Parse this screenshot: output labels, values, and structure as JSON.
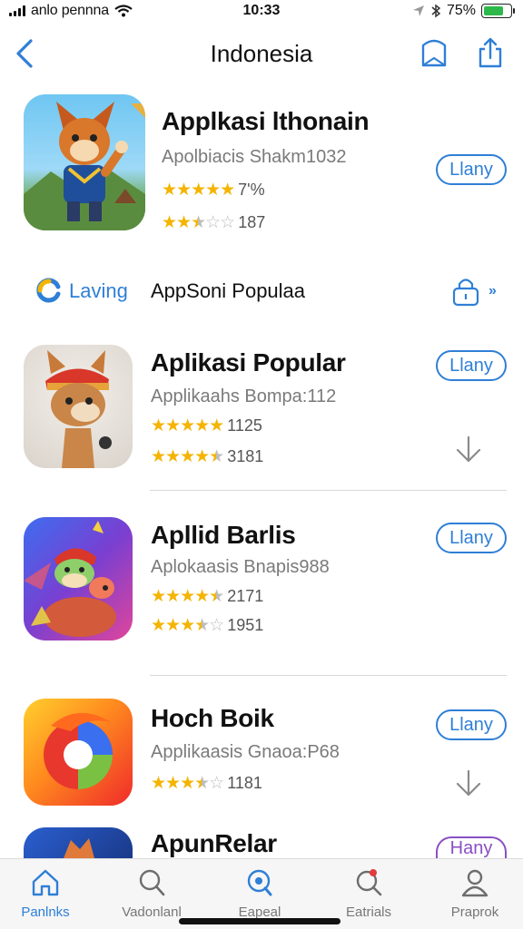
{
  "status_bar": {
    "carrier": "anlo pennna",
    "time": "10:33",
    "battery": "75%",
    "battery_level": 0.75
  },
  "nav": {
    "title": "Indonesia"
  },
  "apps": [
    {
      "name": "Applkasi lthonain",
      "subtitle": "Apolbiacis Shakm1032",
      "rating1_text": "7'%",
      "rating1_stars": 5,
      "rating2_text": "187",
      "rating2_stars": 2.5,
      "button": "Llany"
    },
    {
      "name": "Aplikasi Popular",
      "subtitle": "Applikaahs Bompa:112",
      "rating1_text": "1125",
      "rating1_stars": 5,
      "rating2_text": "3181",
      "rating2_stars": 4.5,
      "button": "Llany"
    },
    {
      "name": "Apllid Barlis",
      "subtitle": "Aplokaasis Bnapis988",
      "rating1_text": "2171",
      "rating1_stars": 4.5,
      "rating2_text": "1951",
      "rating2_stars": 3.5,
      "button": "Llany"
    },
    {
      "name": "Hoch Boik",
      "subtitle": "Applikaasis Gnaoa:P68",
      "rating1_text": "1181",
      "rating1_stars": 3.5,
      "button": "Llany"
    },
    {
      "name": "ApunRelar",
      "button": "Hany"
    }
  ],
  "section": {
    "brand": "Laving",
    "title": "AppSoni Populaa",
    "more": "»"
  },
  "tabs": [
    {
      "label": "Panlnks",
      "icon": "home-icon",
      "active": true
    },
    {
      "label": "Vadonlanl",
      "icon": "search-icon",
      "active": false
    },
    {
      "label": "Eapeal",
      "icon": "search-icon",
      "active": false
    },
    {
      "label": "Eatrials",
      "icon": "search-icon",
      "active": false
    },
    {
      "label": "Praprok",
      "icon": "person-icon",
      "active": false
    }
  ],
  "colors": {
    "accent": "#2f7fd6",
    "star": "#f4b400",
    "purple": "#8a4fc4"
  }
}
